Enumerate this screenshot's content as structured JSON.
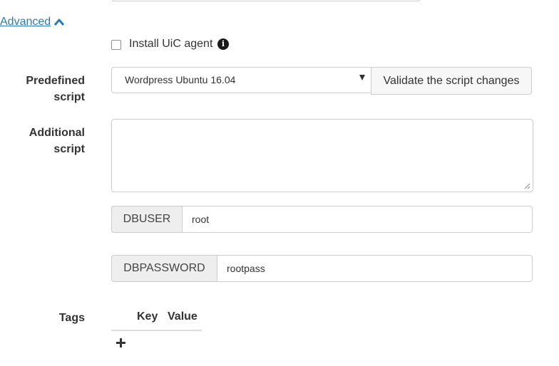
{
  "advanced": {
    "label": "Advanced"
  },
  "install_agent": {
    "label": "Install UiC agent",
    "checked": false
  },
  "predefined_script": {
    "label_line1": "Predefined",
    "label_line2": "script",
    "selected": "Wordpress Ubuntu 16.04",
    "validate_label": "Validate the script changes"
  },
  "additional_script": {
    "label_line1": "Additional",
    "label_line2": "script",
    "value": ""
  },
  "params": [
    {
      "name": "DBUSER",
      "value": "root"
    },
    {
      "name": "DBPASSWORD",
      "value": "rootpass"
    }
  ],
  "tags": {
    "label": "Tags",
    "col_key": "Key",
    "col_value": "Value"
  },
  "icons": {
    "advanced": "chevron-up-icon",
    "info": "info-icon",
    "add": "plus-icon"
  },
  "colors": {
    "link": "#2a7ab7",
    "addon_bg": "#eeeeee",
    "border": "#cccccc"
  }
}
